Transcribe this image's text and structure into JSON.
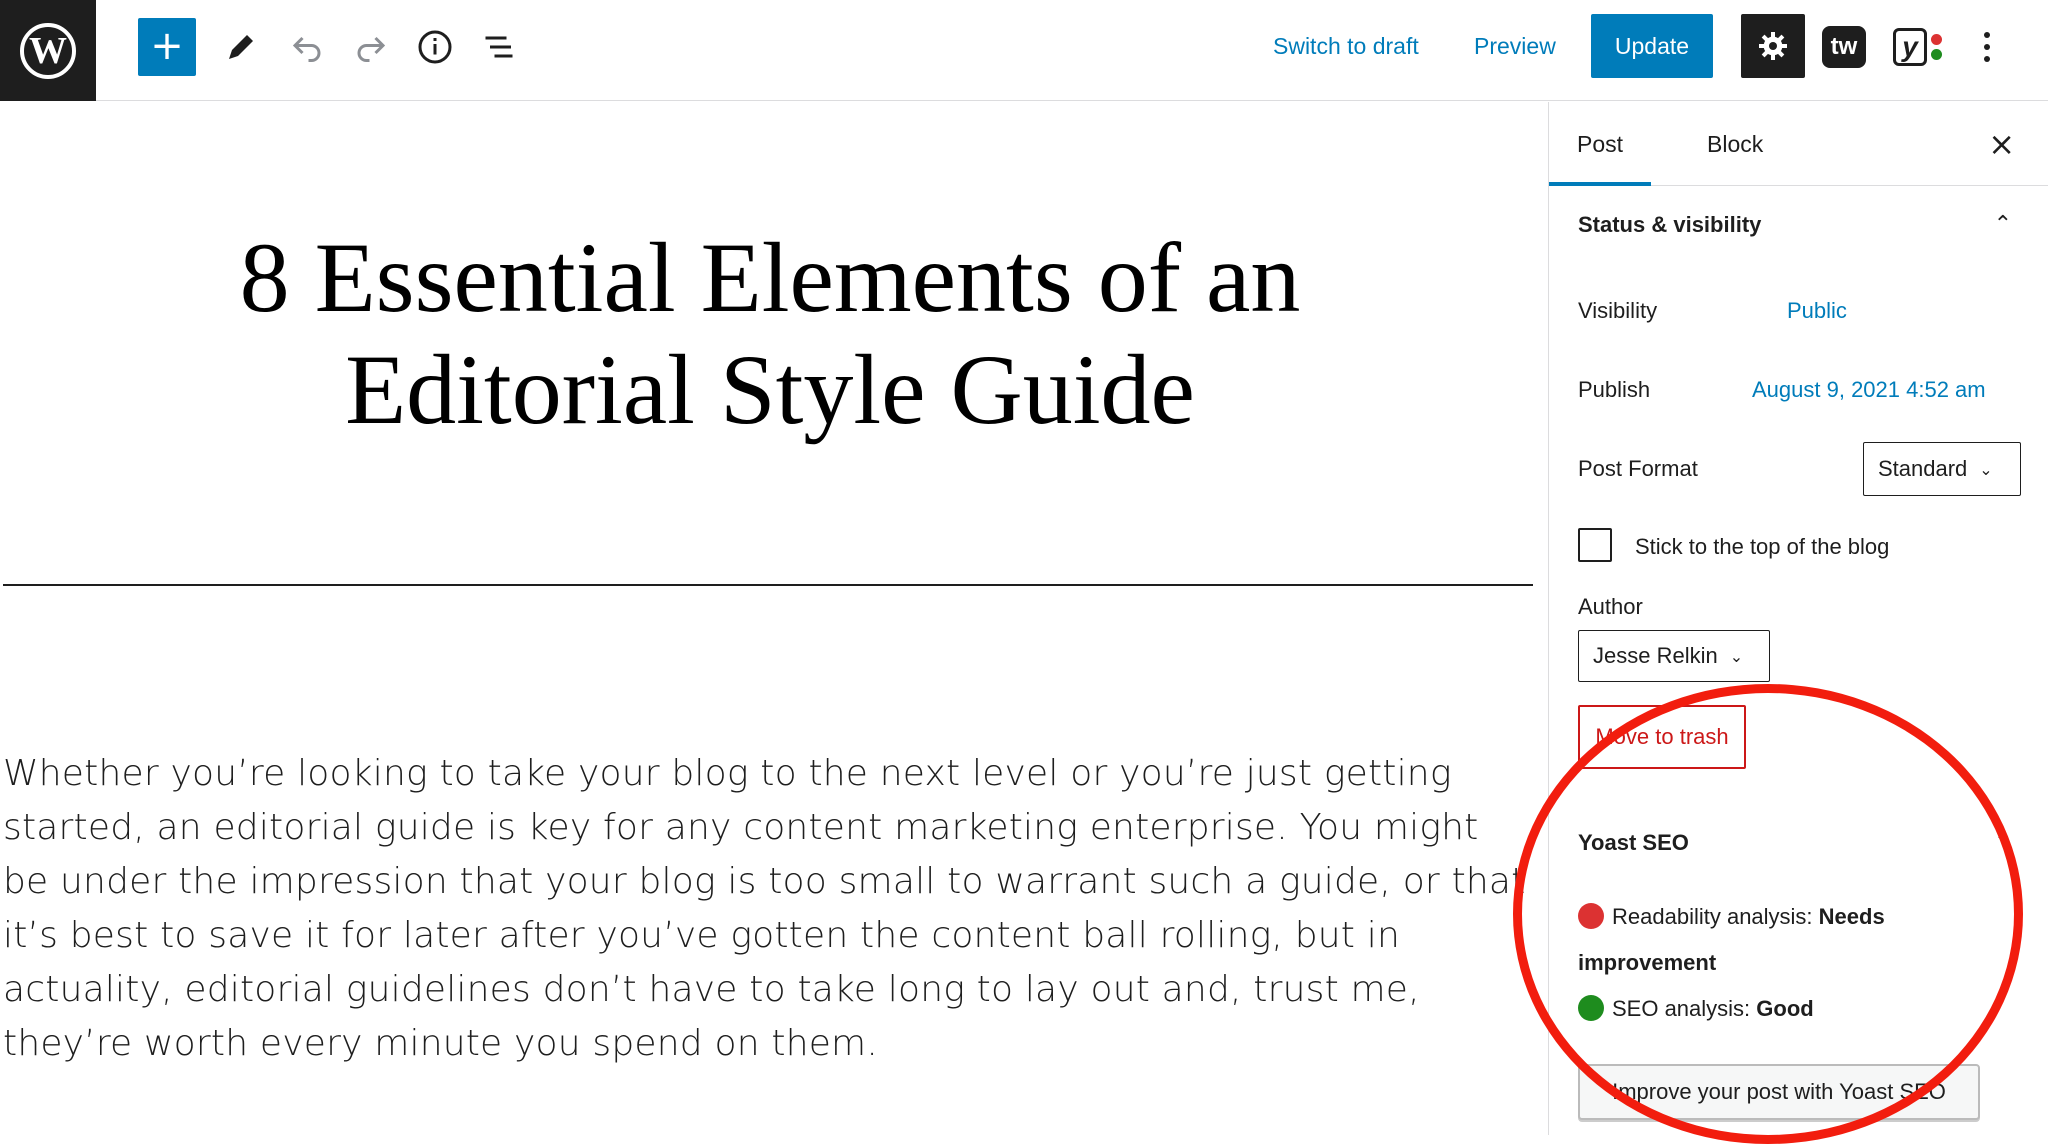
{
  "toolbar": {
    "wp_logo": "W",
    "add_label": "+",
    "switch_to_draft": "Switch to draft",
    "preview": "Preview",
    "update": "Update",
    "tw_label": "tw",
    "yoast_label": "y",
    "icons": [
      "wordpress-icon",
      "plus-icon",
      "pencil-icon",
      "undo-icon",
      "redo-icon",
      "info-icon",
      "list-view-icon",
      "gear-icon",
      "more-icon"
    ]
  },
  "editor": {
    "title": "8 Essential Elements of an Editorial Style Guide",
    "paragraph": "Whether you’re looking to take your blog to the next level or you’re just getting started, an editorial guide is key for any content marketing enterprise. You might be under the impression that your blog is too small to warrant such a guide, or that it’s best to save it for later after you’ve gotten the content ball rolling, but in actuality, editorial guidelines don’t have to take long to lay out and, trust me, they’re worth every minute you spend on them."
  },
  "sidebar": {
    "tabs": [
      {
        "label": "Post"
      },
      {
        "label": "Block"
      }
    ],
    "close": "×",
    "panel_title": "Status & visibility",
    "visibility_label": "Visibility",
    "visibility_value": "Public",
    "publish_label": "Publish",
    "publish_value": "August 9, 2021 4:52 am",
    "post_format_label": "Post Format",
    "post_format_value": "Standard",
    "sticky_label": "Stick to the top of the blog",
    "author_label": "Author",
    "author_value": "Jesse Relkin",
    "trash": "Move to trash",
    "yoast_title": "Yoast SEO",
    "readability_label": "Readability analysis: ",
    "readability_value": "Needs improvement",
    "seo_label": "SEO analysis: ",
    "seo_value": "Good",
    "improve_button": "Improve your post with Yoast SEO"
  },
  "colors": {
    "accent": "#007cba",
    "danger": "#cc1818",
    "highlight": "#f21d0e",
    "bad": "#dc3232",
    "good": "#1e8c1e"
  }
}
